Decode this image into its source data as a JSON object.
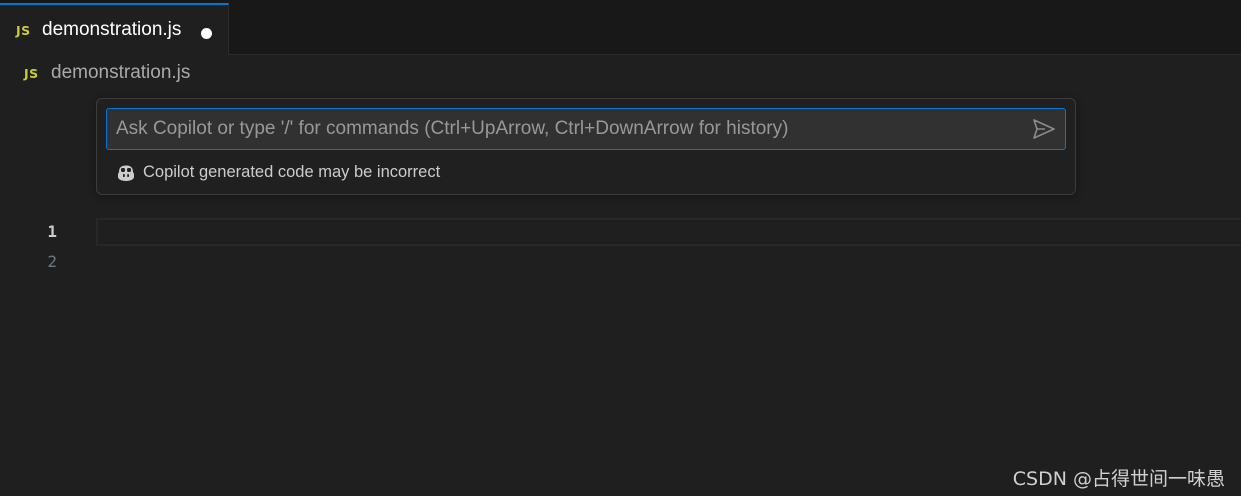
{
  "tab": {
    "icon": "js-file-icon",
    "badge": "JS",
    "label": "demonstration.js",
    "modified_indicator": "unsaved-dot"
  },
  "breadcrumb": {
    "badge": "JS",
    "label": "demonstration.js"
  },
  "copilot_chat": {
    "input_value": "",
    "placeholder": "Ask Copilot or type '/' for commands (Ctrl+UpArrow, Ctrl+DownArrow for history)",
    "send_icon": "send-icon",
    "disclaimer_icon": "copilot-icon",
    "disclaimer": "Copilot generated code may be incorrect"
  },
  "editor": {
    "line_numbers": [
      "1",
      "2"
    ],
    "active_line": "1"
  },
  "watermark": "CSDN @占得世间一味愚",
  "colors": {
    "background": "#1f1f1f",
    "tab_bar": "#181818",
    "accent": "#0078d4",
    "js_badge": "#cbcb41"
  }
}
